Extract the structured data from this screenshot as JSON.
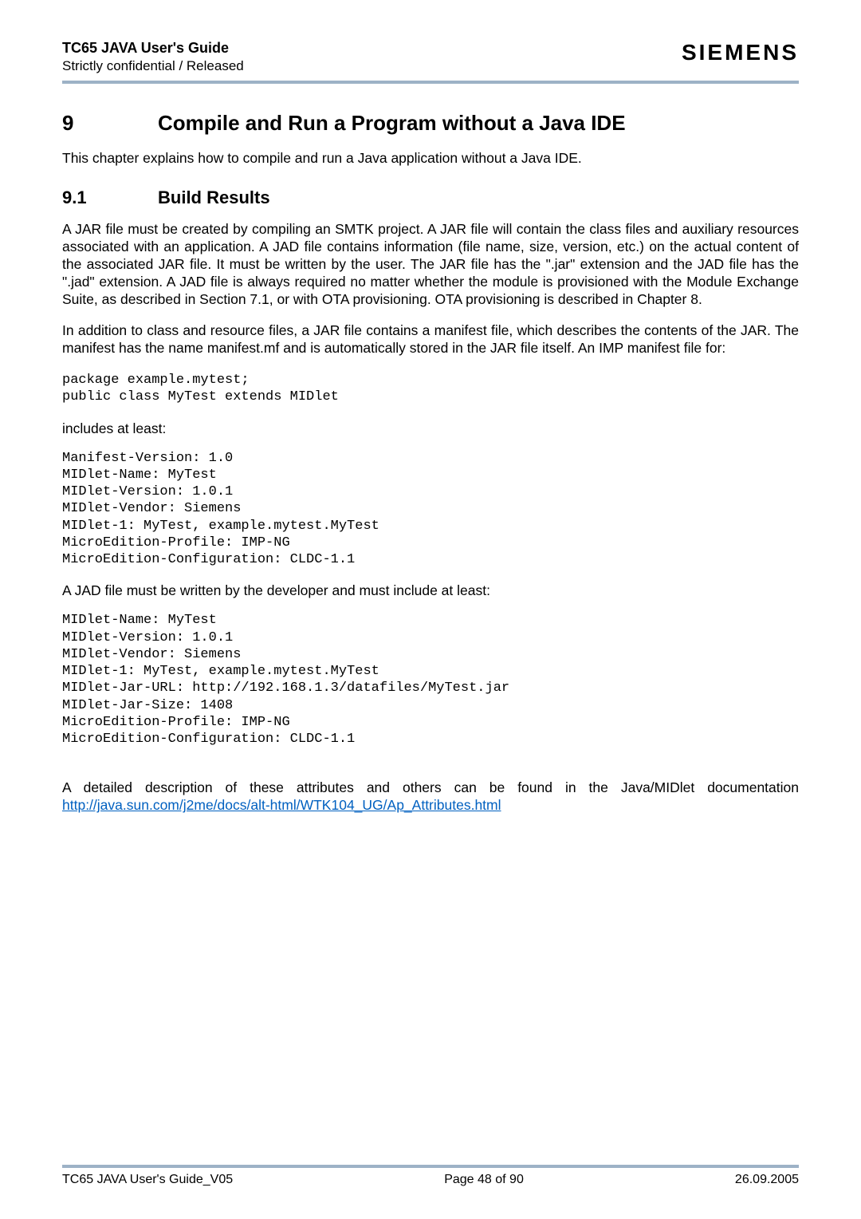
{
  "header": {
    "doc_title": "TC65 JAVA User's Guide",
    "doc_subtitle": "Strictly confidential / Released",
    "brand": "SIEMENS"
  },
  "h1": {
    "num": "9",
    "title": "Compile and Run a Program without a Java IDE"
  },
  "p_intro": "This chapter explains how to compile and run a Java application without a Java IDE.",
  "h2": {
    "num": "9.1",
    "title": "Build Results"
  },
  "p1": "A JAR file must be created by compiling an SMTK project. A JAR file will contain the class files and auxiliary resources associated with an application. A JAD file contains information (file name, size, version, etc.) on the actual content of the associated JAR file. It must be written by the user. The JAR file has the \".jar\" extension and the JAD file has the \".jad\" extension. A JAD file is always required no matter whether the module is provisioned with the Module Exchange Suite, as described in Section 7.1, or with OTA provisioning. OTA provisioning is described in Chapter 8.",
  "p2": "In addition to class and resource files, a JAR file contains a manifest file, which describes the contents of the JAR. The manifest has the name manifest.mf and is automatically stored in the JAR file itself. An IMP manifest file for:",
  "code1": "package example.mytest;\npublic class MyTest extends MIDlet",
  "p3": "includes at least:",
  "code2": "Manifest-Version: 1.0\nMIDlet-Name: MyTest\nMIDlet-Version: 1.0.1\nMIDlet-Vendor: Siemens\nMIDlet-1: MyTest, example.mytest.MyTest\nMicroEdition-Profile: IMP-NG\nMicroEdition-Configuration: CLDC-1.1",
  "p4": "A JAD file must be written by the developer and must include at least:",
  "code3": "MIDlet-Name: MyTest\nMIDlet-Version: 1.0.1\nMIDlet-Vendor: Siemens\nMIDlet-1: MyTest, example.mytest.MyTest\nMIDlet-Jar-URL: http://192.168.1.3/datafiles/MyTest.jar\nMIDlet-Jar-Size: 1408\nMicroEdition-Profile: IMP-NG\nMicroEdition-Configuration: CLDC-1.1",
  "p5_prefix": "A detailed description of these attributes and others can be found in the Java/MIDlet documentation ",
  "p5_link_text": "http://java.sun.com/j2me/docs/alt-html/WTK104_UG/Ap_Attributes.html",
  "footer": {
    "left": "TC65 JAVA User's Guide_V05",
    "center": "Page 48 of 90",
    "right": "26.09.2005"
  }
}
